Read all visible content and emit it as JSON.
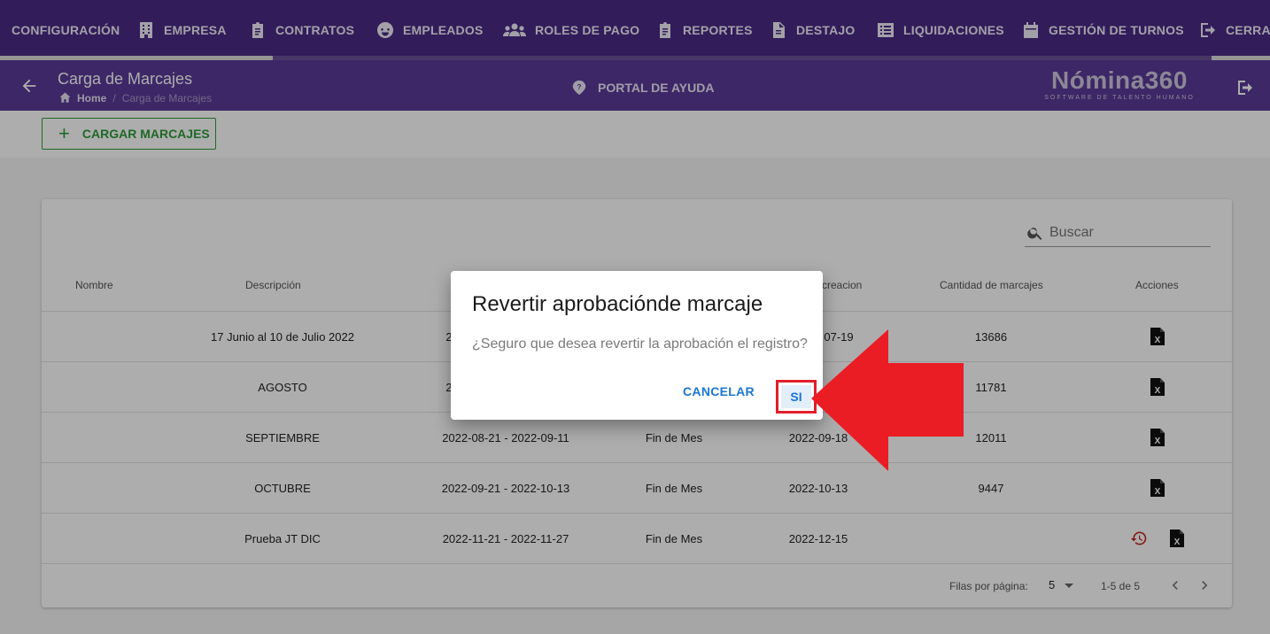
{
  "nav": {
    "items": [
      {
        "label": "CONFIGURACIÓN",
        "icon": "none"
      },
      {
        "label": "EMPRESA",
        "icon": "building-icon"
      },
      {
        "label": "CONTRATOS",
        "icon": "clipboard-icon"
      },
      {
        "label": "EMPLEADOS",
        "icon": "face-icon"
      },
      {
        "label": "ROLES DE PAGO",
        "icon": "people-icon"
      },
      {
        "label": "REPORTES",
        "icon": "clipboard-icon"
      },
      {
        "label": "DESTAJO",
        "icon": "document-icon"
      },
      {
        "label": "LIQUIDACIONES",
        "icon": "list-icon"
      },
      {
        "label": "GESTIÓN DE TURNOS",
        "icon": "calendar-icon"
      },
      {
        "label": "CERRA",
        "icon": "logout-icon"
      }
    ]
  },
  "header": {
    "title": "Carga de Marcajes",
    "breadcrumb_home": "Home",
    "breadcrumb_sep": "/",
    "breadcrumb_current": "Carga de Marcajes",
    "help_label": "PORTAL DE AYUDA",
    "logo_name": "Nómina360",
    "logo_tagline": "SOFTWARE DE TALENTO HUMANO"
  },
  "toolbar": {
    "cargar_plus": "+",
    "cargar_label": "CARGAR MARCAJES"
  },
  "search": {
    "placeholder": "Buscar"
  },
  "table": {
    "headers": {
      "nombre": "Nombre",
      "descripcion": "Descripción",
      "fecha_creacion": "creacion",
      "cantidad": "Cantidad de marcajes",
      "acciones": "Acciones"
    },
    "rows": [
      {
        "descripcion": "17 Junio al 10 de Julio 2022",
        "periodo": "2",
        "tipo": "",
        "fecha": "07-19",
        "cantidad": "13686",
        "revert": false
      },
      {
        "descripcion": "AGOSTO",
        "periodo": "2",
        "tipo": "",
        "fecha": "",
        "cantidad": "11781",
        "revert": false
      },
      {
        "descripcion": "SEPTIEMBRE",
        "periodo": "2022-08-21 - 2022-09-11",
        "tipo": "Fin de Mes",
        "fecha": "2022-09-18",
        "cantidad": "12011",
        "revert": false
      },
      {
        "descripcion": "OCTUBRE",
        "periodo": "2022-09-21 - 2022-10-13",
        "tipo": "Fin de Mes",
        "fecha": "2022-10-13",
        "cantidad": "9447",
        "revert": false
      },
      {
        "descripcion": "Prueba JT DIC",
        "periodo": "2022-11-21 - 2022-11-27",
        "tipo": "Fin de Mes",
        "fecha": "2022-12-15",
        "cantidad": "",
        "revert": true
      }
    ]
  },
  "pagination": {
    "rows_per_page_label": "Filas por página:",
    "rows_per_page": "5",
    "range": "1-5 de 5"
  },
  "dialog": {
    "title": "Revertir aprobaciónde marcaje",
    "message": "¿Seguro que desea revertir la aprobación el registro?",
    "cancel_label": "CANCELAR",
    "confirm_label": "SI"
  },
  "colors": {
    "nav_bg": "#4a2a85",
    "subheader_bg": "#5a3a98",
    "accent_green": "#2e9b3a",
    "link_blue": "#1976d2",
    "highlight_red": "#e0202a"
  }
}
